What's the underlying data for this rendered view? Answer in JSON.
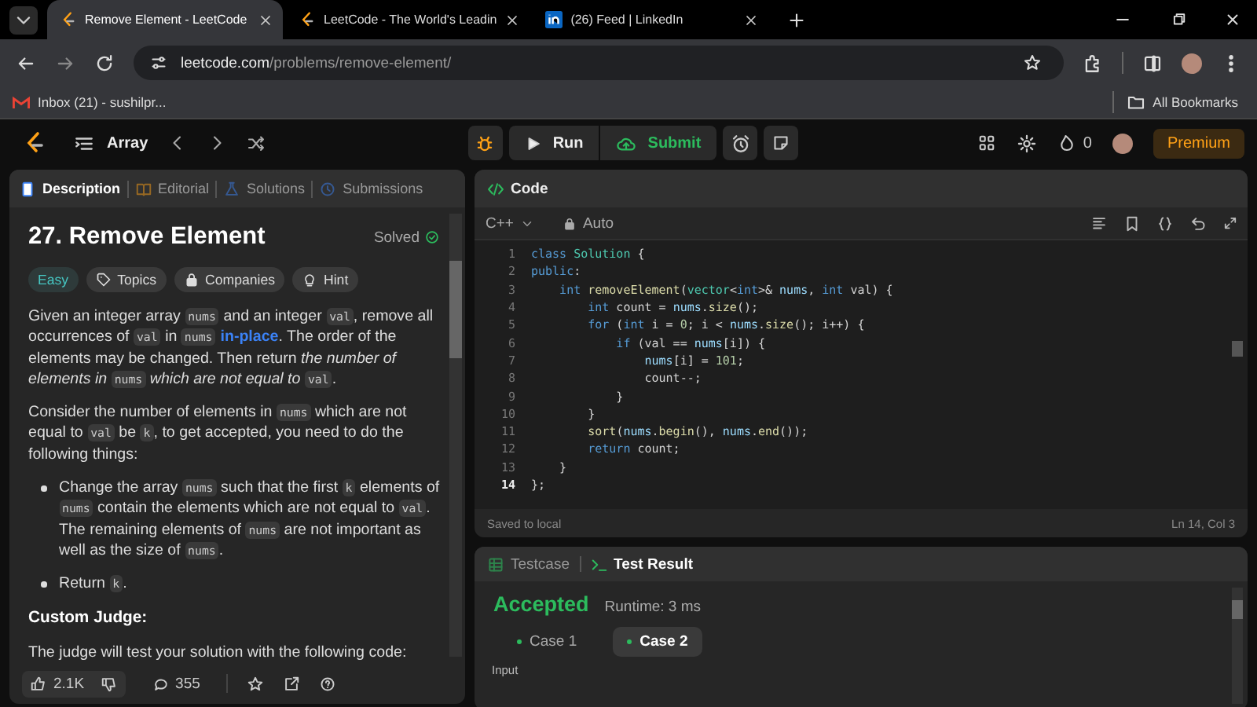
{
  "browser": {
    "tabs": [
      {
        "title": "Remove Element - LeetCode",
        "selected": true
      },
      {
        "title": "LeetCode - The World's Leadin",
        "selected": false
      },
      {
        "title": "(26) Feed | LinkedIn",
        "selected": false
      }
    ],
    "address": {
      "host": "leetcode.com",
      "path": "/problems/remove-element/"
    },
    "bookmarks": [
      {
        "label": "Inbox (21) - sushilpr..."
      }
    ],
    "all_bookmarks": "All Bookmarks"
  },
  "topbar": {
    "list_name": "Array",
    "run": "Run",
    "submit": "Submit",
    "streak": "0",
    "premium": "Premium"
  },
  "description": {
    "tabs": [
      {
        "label": "Description",
        "selected": true
      },
      {
        "label": "Editorial",
        "selected": false
      },
      {
        "label": "Solutions",
        "selected": false
      },
      {
        "label": "Submissions",
        "selected": false
      }
    ],
    "title": "27. Remove Element",
    "status": "Solved",
    "tags": [
      {
        "label": "Easy",
        "kind": "difficulty"
      },
      {
        "label": "Topics",
        "kind": "topics"
      },
      {
        "label": "Companies",
        "kind": "companies"
      },
      {
        "label": "Hint",
        "kind": "hint"
      }
    ],
    "blocks": [
      {
        "kind": "paragraph",
        "parts": [
          {
            "kind": "text",
            "text": "Given an integer array "
          },
          {
            "kind": "code",
            "text": "nums"
          },
          {
            "kind": "text",
            "text": " and an integer "
          },
          {
            "kind": "code",
            "text": "val"
          },
          {
            "kind": "text",
            "text": ", remove all occurrences of "
          },
          {
            "kind": "code",
            "text": "val"
          },
          {
            "kind": "text",
            "text": " in "
          },
          {
            "kind": "code",
            "text": "nums"
          },
          {
            "kind": "link",
            "text": "in-place"
          },
          {
            "kind": "text",
            "text": ". The order of the elements may be changed. Then return "
          },
          {
            "kind": "italic",
            "text": "the number of elements in "
          },
          {
            "kind": "code",
            "text": "nums"
          },
          {
            "kind": "italic",
            "text": " which are not equal to "
          },
          {
            "kind": "code",
            "text": "val"
          },
          {
            "kind": "text",
            "text": "."
          }
        ]
      },
      {
        "kind": "paragraph",
        "parts": [
          {
            "kind": "text",
            "text": "Consider the number of elements in "
          },
          {
            "kind": "code",
            "text": "nums"
          },
          {
            "kind": "text",
            "text": " which are not equal to "
          },
          {
            "kind": "code",
            "text": "val"
          },
          {
            "kind": "text",
            "text": " be "
          },
          {
            "kind": "code",
            "text": "k"
          },
          {
            "kind": "text",
            "text": ", to get accepted, you need to do the following things:"
          }
        ]
      },
      {
        "kind": "bullets",
        "items": [
          [
            {
              "kind": "text",
              "text": "Change the array "
            },
            {
              "kind": "code",
              "text": "nums"
            },
            {
              "kind": "text",
              "text": " such that the first "
            },
            {
              "kind": "code",
              "text": "k"
            },
            {
              "kind": "text",
              "text": " elements of "
            },
            {
              "kind": "code",
              "text": "nums"
            },
            {
              "kind": "text",
              "text": " contain the elements which are not equal to "
            },
            {
              "kind": "code",
              "text": "val"
            },
            {
              "kind": "text",
              "text": ". The remaining elements of "
            },
            {
              "kind": "code",
              "text": "nums"
            },
            {
              "kind": "text",
              "text": " are not important as well as the size of "
            },
            {
              "kind": "code",
              "text": "nums"
            },
            {
              "kind": "text",
              "text": "."
            }
          ],
          [
            {
              "kind": "text",
              "text": "Return "
            },
            {
              "kind": "code",
              "text": "k"
            },
            {
              "kind": "text",
              "text": "."
            }
          ]
        ]
      },
      {
        "kind": "heading",
        "text": "Custom Judge:"
      },
      {
        "kind": "paragraph",
        "parts": [
          {
            "kind": "text",
            "text": "The judge will test your solution with the following code:"
          }
        ]
      }
    ],
    "likes": "2.1K",
    "comments": "355"
  },
  "editor": {
    "title": "Code",
    "language": "C++",
    "mode": "Auto",
    "lines": [
      {
        "number": "1",
        "current": false,
        "tokens": [
          {
            "kind": "keyword",
            "text": "class"
          },
          {
            "kind": "type",
            "text": " Solution"
          },
          {
            "kind": "plain",
            "text": " {"
          }
        ]
      },
      {
        "number": "2",
        "current": false,
        "tokens": [
          {
            "kind": "keyword",
            "text": "public"
          },
          {
            "kind": "plain",
            "text": ":"
          }
        ]
      },
      {
        "number": "3",
        "current": false,
        "tokens": [
          {
            "kind": "keyword",
            "text": "    int"
          },
          {
            "kind": "function",
            "text": " removeElement"
          },
          {
            "kind": "plain",
            "text": "("
          },
          {
            "kind": "type",
            "text": "vector"
          },
          {
            "kind": "plain",
            "text": "<"
          },
          {
            "kind": "keyword",
            "text": "int"
          },
          {
            "kind": "plain",
            "text": ">& "
          },
          {
            "kind": "variable",
            "text": "nums"
          },
          {
            "kind": "plain",
            "text": ", "
          },
          {
            "kind": "keyword",
            "text": "int"
          },
          {
            "kind": "plain",
            "text": " val) {"
          }
        ]
      },
      {
        "number": "4",
        "current": false,
        "tokens": [
          {
            "kind": "keyword",
            "text": "        int"
          },
          {
            "kind": "plain",
            "text": " count = "
          },
          {
            "kind": "variable",
            "text": "nums"
          },
          {
            "kind": "plain",
            "text": "."
          },
          {
            "kind": "function",
            "text": "size"
          },
          {
            "kind": "plain",
            "text": "();"
          }
        ]
      },
      {
        "number": "5",
        "current": false,
        "tokens": [
          {
            "kind": "keyword",
            "text": "        for"
          },
          {
            "kind": "plain",
            "text": " ("
          },
          {
            "kind": "keyword",
            "text": "int"
          },
          {
            "kind": "plain",
            "text": " i = "
          },
          {
            "kind": "number",
            "text": "0"
          },
          {
            "kind": "plain",
            "text": "; i < "
          },
          {
            "kind": "variable",
            "text": "nums"
          },
          {
            "kind": "plain",
            "text": "."
          },
          {
            "kind": "function",
            "text": "size"
          },
          {
            "kind": "plain",
            "text": "(); i++) {"
          }
        ]
      },
      {
        "number": "6",
        "current": false,
        "tokens": [
          {
            "kind": "keyword",
            "text": "            if"
          },
          {
            "kind": "plain",
            "text": " (val == "
          },
          {
            "kind": "variable",
            "text": "nums"
          },
          {
            "kind": "plain",
            "text": "[i]) {"
          }
        ]
      },
      {
        "number": "7",
        "current": false,
        "tokens": [
          {
            "kind": "variable",
            "text": "                nums"
          },
          {
            "kind": "plain",
            "text": "[i] = "
          },
          {
            "kind": "number",
            "text": "101"
          },
          {
            "kind": "plain",
            "text": ";"
          }
        ]
      },
      {
        "number": "8",
        "current": false,
        "tokens": [
          {
            "kind": "plain",
            "text": "                count--;"
          }
        ]
      },
      {
        "number": "9",
        "current": false,
        "tokens": [
          {
            "kind": "plain",
            "text": "            }"
          }
        ]
      },
      {
        "number": "10",
        "current": false,
        "tokens": [
          {
            "kind": "plain",
            "text": "        }"
          }
        ]
      },
      {
        "number": "11",
        "current": false,
        "tokens": [
          {
            "kind": "function",
            "text": "        sort"
          },
          {
            "kind": "plain",
            "text": "("
          },
          {
            "kind": "variable",
            "text": "nums"
          },
          {
            "kind": "plain",
            "text": "."
          },
          {
            "kind": "function",
            "text": "begin"
          },
          {
            "kind": "plain",
            "text": "(), "
          },
          {
            "kind": "variable",
            "text": "nums"
          },
          {
            "kind": "plain",
            "text": "."
          },
          {
            "kind": "function",
            "text": "end"
          },
          {
            "kind": "plain",
            "text": "());"
          }
        ]
      },
      {
        "number": "12",
        "current": false,
        "tokens": [
          {
            "kind": "keyword",
            "text": "        return"
          },
          {
            "kind": "plain",
            "text": " count;"
          }
        ]
      },
      {
        "number": "13",
        "current": false,
        "tokens": [
          {
            "kind": "plain",
            "text": "    }"
          }
        ]
      },
      {
        "number": "14",
        "current": true,
        "tokens": [
          {
            "kind": "plain",
            "text": "};"
          }
        ]
      }
    ],
    "status": "Saved to local",
    "cursor": "Ln 14, Col 3"
  },
  "result": {
    "tabs": [
      {
        "label": "Testcase",
        "selected": false
      },
      {
        "label": "Test Result",
        "selected": true
      }
    ],
    "verdict": "Accepted",
    "runtime": "Runtime: 3 ms",
    "cases": [
      {
        "label": "Case 1",
        "selected": false
      },
      {
        "label": "Case 2",
        "selected": true
      }
    ],
    "section": "Input"
  }
}
